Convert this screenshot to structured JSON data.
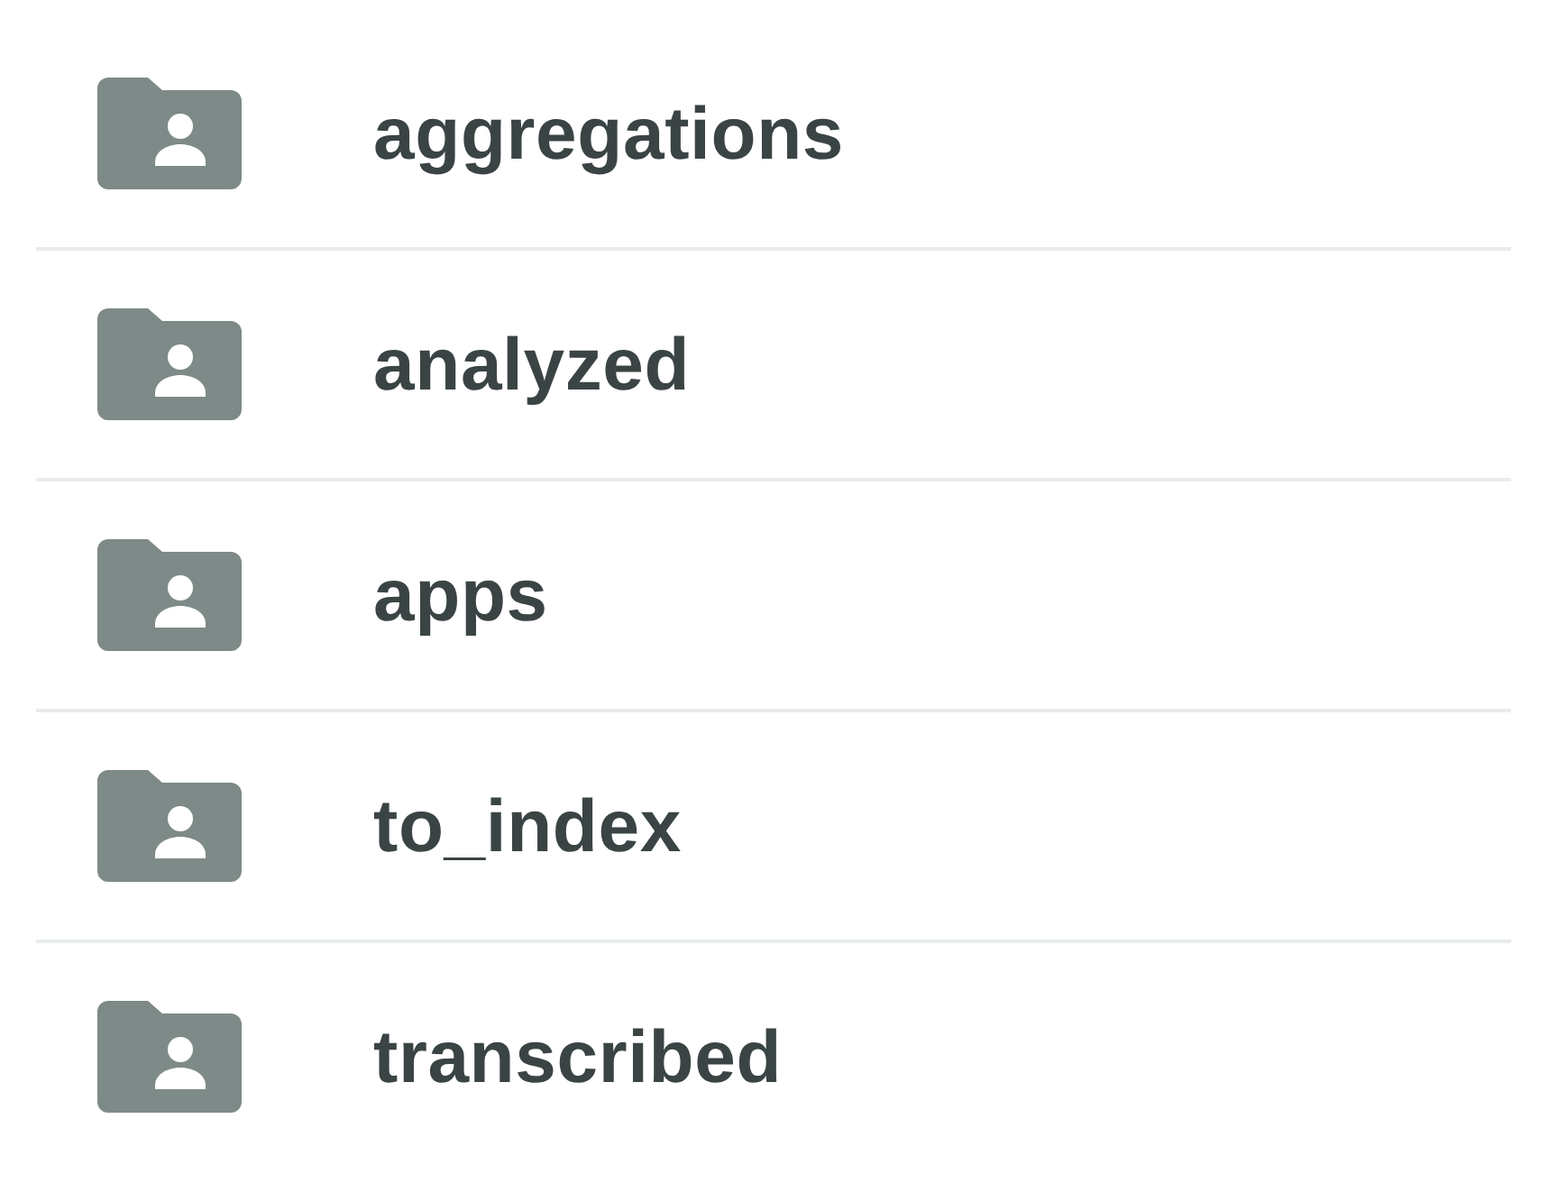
{
  "folders": [
    {
      "name": "aggregations"
    },
    {
      "name": "analyzed"
    },
    {
      "name": "apps"
    },
    {
      "name": "to_index"
    },
    {
      "name": "transcribed"
    }
  ]
}
